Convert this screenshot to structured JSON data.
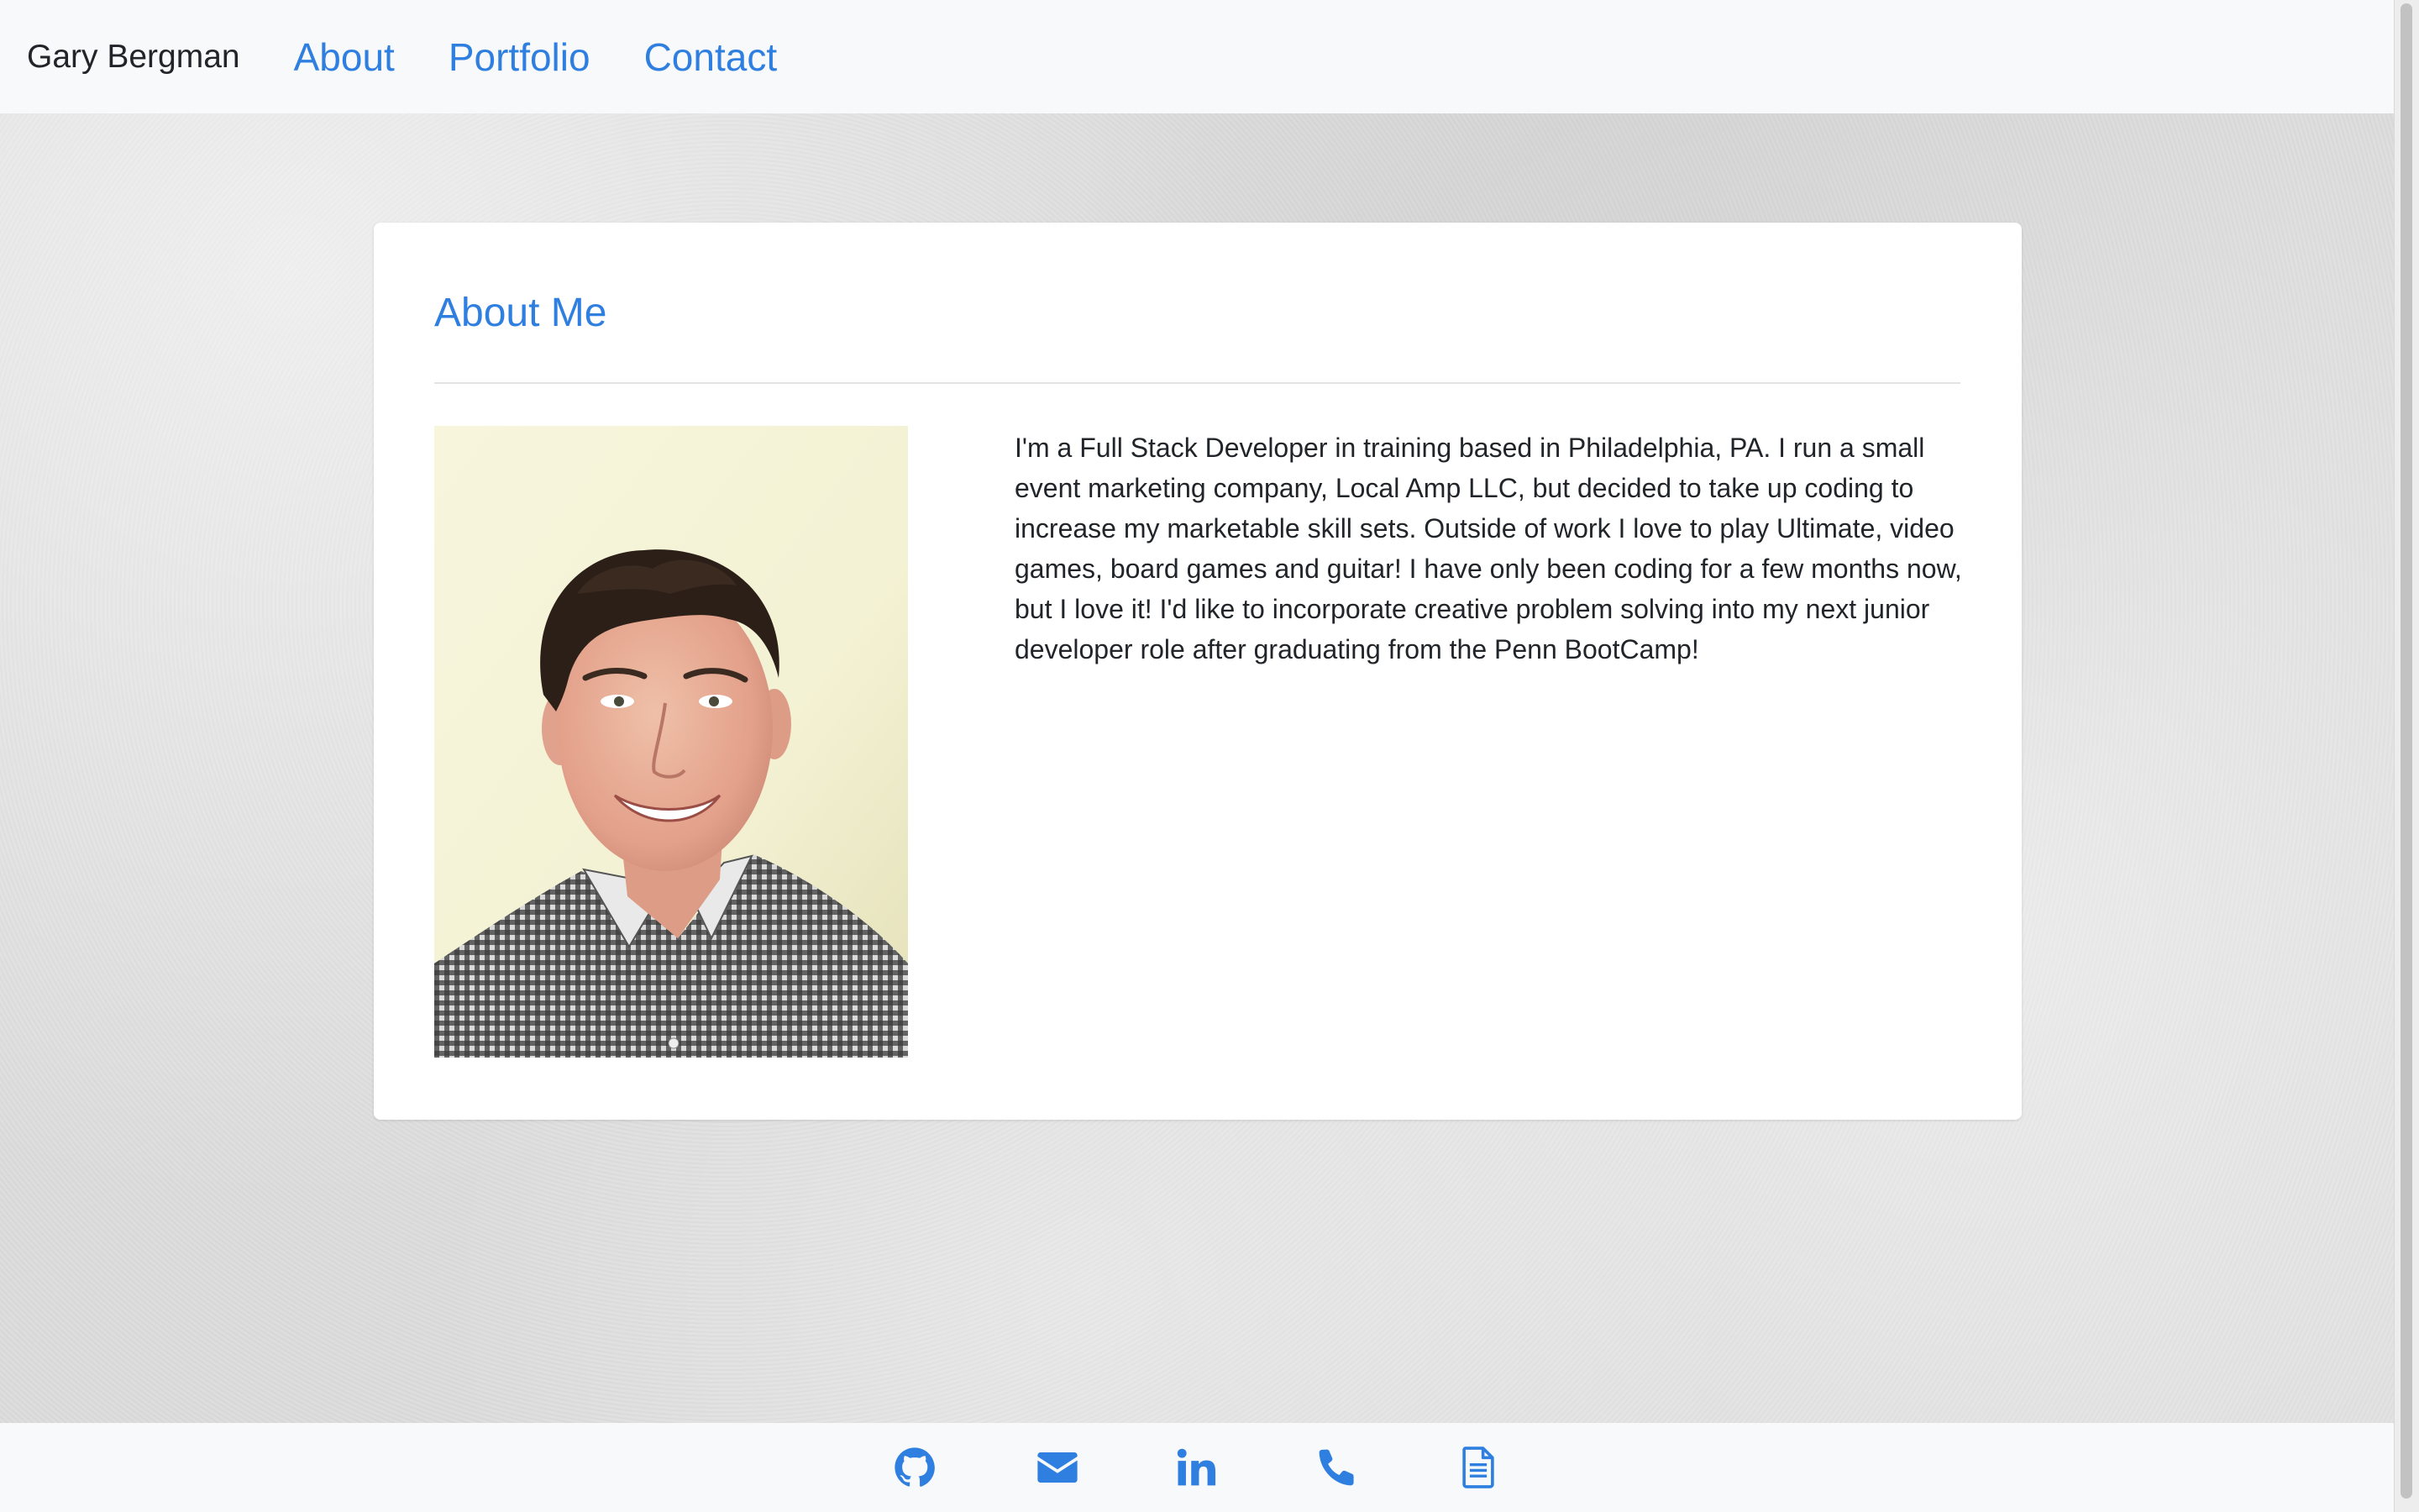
{
  "navbar": {
    "brand": "Gary Bergman",
    "links": [
      {
        "label": "About"
      },
      {
        "label": "Portfolio"
      },
      {
        "label": "Contact"
      }
    ]
  },
  "about": {
    "title": "About Me",
    "photo_subject": "headshot-photo",
    "bio": "I'm a Full Stack Developer in training based in Philadelphia, PA. I run a small event marketing company, Local Amp LLC, but decided to take up coding to increase my marketable skill sets. Outside of work I love to play Ultimate, video games, board games and guitar! I have only been coding for a few months now, but I love it! I'd like to incorporate creative problem solving into my next junior developer role after graduating from the Penn BootCamp!"
  },
  "footer": {
    "icons": [
      {
        "name": "github-icon"
      },
      {
        "name": "envelope-icon"
      },
      {
        "name": "linkedin-icon"
      },
      {
        "name": "phone-icon"
      },
      {
        "name": "document-icon"
      }
    ]
  },
  "colors": {
    "accent": "#2f7fe0",
    "navbar_bg": "#f8f9fa",
    "text": "#212529",
    "card_bg": "#ffffff"
  }
}
